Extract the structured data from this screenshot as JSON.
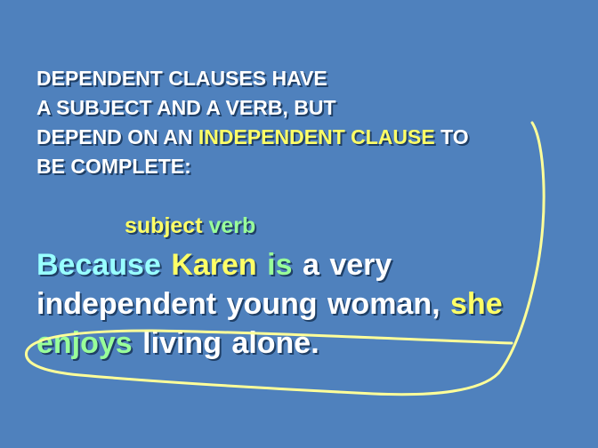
{
  "heading": {
    "line1": "DEPENDENT CLAUSES HAVE",
    "line2": "A SUBJECT AND A VERB, BUT",
    "line3_start": "DEPEND ON AN ",
    "line3_highlight": "INDEPENDENT CLAUSE",
    "line3_end": " TO",
    "line4": "BE COMPLETE:"
  },
  "labels": {
    "subject": "subject",
    "verb": "verb"
  },
  "sentence": {
    "because": "Because",
    "karen": "Karen",
    "is": "is",
    "rest1": "a very",
    "rest2": "independent young woman,",
    "she": "she",
    "enjoys": "enjoys",
    "rest3": "living alone."
  },
  "colors": {
    "background": "#4f81bd",
    "heading_text": "#ffffff",
    "highlight_yellow": "#ffff66",
    "highlight_green": "#99ff99",
    "highlight_cyan": "#99ffff",
    "ink_annotation": "#ffff99"
  }
}
